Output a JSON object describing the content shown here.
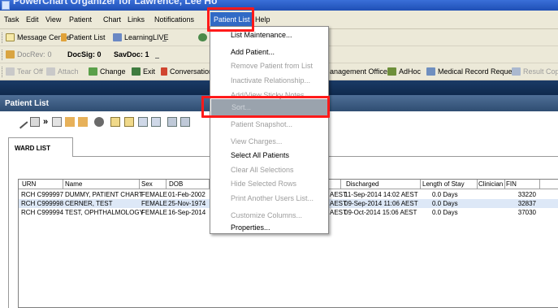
{
  "window": {
    "title": "PowerChart Organizer for Lawrence, Lee Ho"
  },
  "menubar": {
    "items": [
      "Task",
      "Edit",
      "View",
      "Patient",
      "Chart",
      "Links",
      "Notifications",
      "Patient List",
      "Help"
    ],
    "active": "Patient List"
  },
  "toolbar1": {
    "message_centre": "Message Centre",
    "patient_list": "Patient List",
    "learning_live": "LearningLIVE"
  },
  "toolbar2": {
    "docrev_label": "DocRev:",
    "docrev_value": "0",
    "docsig": "DocSig: 0",
    "savdoc": "SavDoc: 1"
  },
  "toolbar3": {
    "tear_off": "Tear Off",
    "attach": "Attach",
    "change": "Change",
    "exit": "Exit",
    "conversation": "Conversation",
    "management_office": "anagement Office",
    "adhoc": "AdHoc",
    "medical_record_request": "Medical Record Request",
    "result_copy": "Result Cop"
  },
  "panel": {
    "title": "Patient List"
  },
  "tab": {
    "label": "WARD LIST"
  },
  "grid": {
    "headers": [
      "URN",
      "Name",
      "Sex",
      "DOB",
      "Discharged",
      "Length of Stay",
      "Clinician",
      "FIN"
    ],
    "rows": [
      {
        "urn": "RCH C999997",
        "name": "DUMMY, PATIENT CHART",
        "sex": "FEMALE",
        "dob": "01-Feb-2002",
        "tz": "AEST",
        "discharged": "11-Sep-2014 14:02 AEST",
        "los": "0.0 Days",
        "fin": "33220"
      },
      {
        "urn": "RCH C999998",
        "name": "CERNER, TEST",
        "sex": "FEMALE",
        "dob": "25-Nov-1974",
        "tz": "AEST",
        "discharged": "09-Sep-2014 11:06 AEST",
        "los": "0.0 Days",
        "fin": "32837"
      },
      {
        "urn": "RCH C999994",
        "name": "TEST, OPHTHALMOLOGY",
        "sex": "FEMALE",
        "dob": "16-Sep-2014",
        "tz": "AEST",
        "discharged": "09-Oct-2014 15:06 AEST",
        "los": "0.0 Days",
        "fin": "37030"
      }
    ]
  },
  "dropdown": {
    "items": [
      {
        "label": "List Maintenance...",
        "enabled": true
      },
      {
        "label": "Add Patient...",
        "enabled": true
      },
      {
        "label": "Remove Patient from List",
        "enabled": false
      },
      {
        "label": "Inactivate Relationship...",
        "enabled": false
      },
      {
        "label": "Add/View Sticky Notes",
        "enabled": false
      },
      {
        "label": "Sort...",
        "enabled": false,
        "hover": true
      },
      {
        "label": "Patient Snapshot...",
        "enabled": false
      },
      {
        "label": "View Charges...",
        "enabled": false
      },
      {
        "label": "Select All Patients",
        "enabled": true
      },
      {
        "label": "Clear All Selections",
        "enabled": false
      },
      {
        "label": "Hide Selected Rows",
        "enabled": false
      },
      {
        "label": "Print Another Users List...",
        "enabled": false
      },
      {
        "label": "Customize Columns...",
        "enabled": false
      },
      {
        "label": "Properties...",
        "enabled": true
      }
    ]
  },
  "colors": {
    "highlight": "#ff1a1a",
    "menu_active": "#316ac5",
    "panel_header": "#2f4d72",
    "row_alt": "#dde8f7"
  }
}
